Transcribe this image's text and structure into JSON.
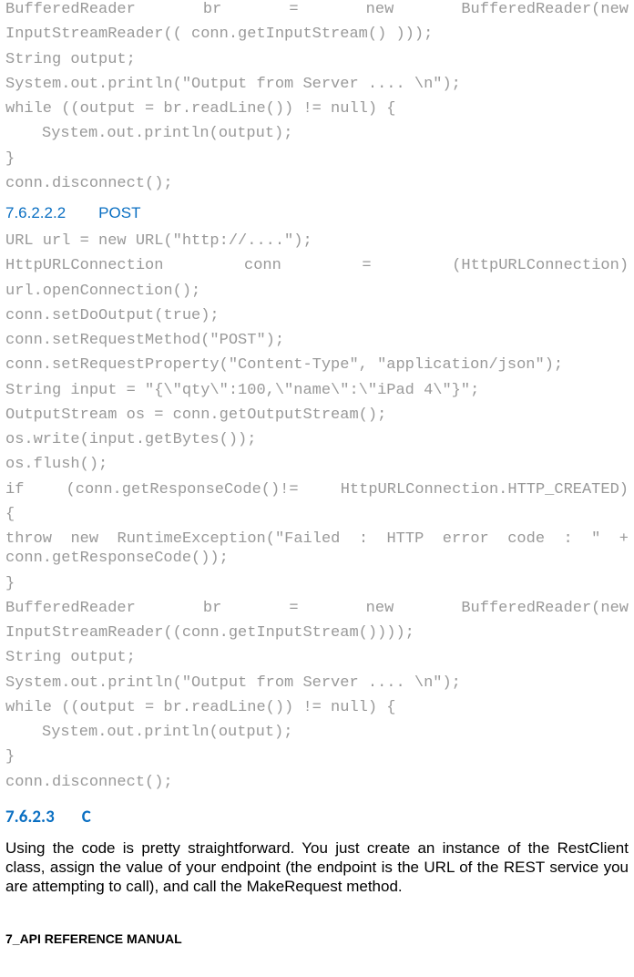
{
  "code_block_1": {
    "l1a": "BufferedReader",
    "l1b": "br",
    "l1c": "=",
    "l1d": "new",
    "l1e": "BufferedReader(new",
    "l2": "InputStreamReader(( conn.getInputStream() )));",
    "l3": "String output;",
    "l4": "System.out.println(\"Output from Server .... \\n\");",
    "l5": "while ((output = br.readLine()) != null) {",
    "l6": "System.out.println(output);",
    "l7": "}",
    "l8": "conn.disconnect();"
  },
  "heading_post": {
    "num": "7.6.2.2.2",
    "title": "POST"
  },
  "code_block_2": {
    "l1": "URL url = new URL(\"http://....\");",
    "l2a": "HttpURLConnection",
    "l2b": "conn",
    "l2c": "=",
    "l2d": "(HttpURLConnection)",
    "l3": "url.openConnection();",
    "l4": "conn.setDoOutput(true);",
    "l5": "conn.setRequestMethod(\"POST\");",
    "l6": "conn.setRequestProperty(\"Content-Type\", \"application/json\");",
    "l7": "String input = \"{\\\"qty\\\":100,\\\"name\\\":\\\"iPad 4\\\"}\";",
    "l8": "OutputStream os = conn.getOutputStream();",
    "l9": "os.write(input.getBytes());",
    "l10": " os.flush();",
    "l11a": "if",
    "l11b": "(conn.getResponseCode()!=",
    "l11c": "HttpURLConnection.HTTP_CREATED)",
    "l12": "{",
    "l13": "    throw new RuntimeException(\"Failed : HTTP error code : \" + conn.getResponseCode());",
    "l14": "}",
    "l15a": "BufferedReader",
    "l15b": "br",
    "l15c": "=",
    "l15d": "new",
    "l15e": "BufferedReader(new",
    "l16": "InputStreamReader((conn.getInputStream())));",
    "l17": "String output;",
    "l18": "System.out.println(\"Output from Server .... \\n\");",
    "l19": "while ((output = br.readLine()) != null) {",
    "l20": "System.out.println(output);",
    "l21": "}",
    "l22": "conn.disconnect();"
  },
  "heading_c": {
    "num": "7.6.2.3",
    "title": "C"
  },
  "body_paragraph": "Using the code is pretty straightforward. You just create an instance of the RestClient class, assign the value of your endpoint (the endpoint is the URL of the REST service you are attempting to call), and call the MakeRequest method.",
  "footer": "7_API REFERENCE MANUAL"
}
